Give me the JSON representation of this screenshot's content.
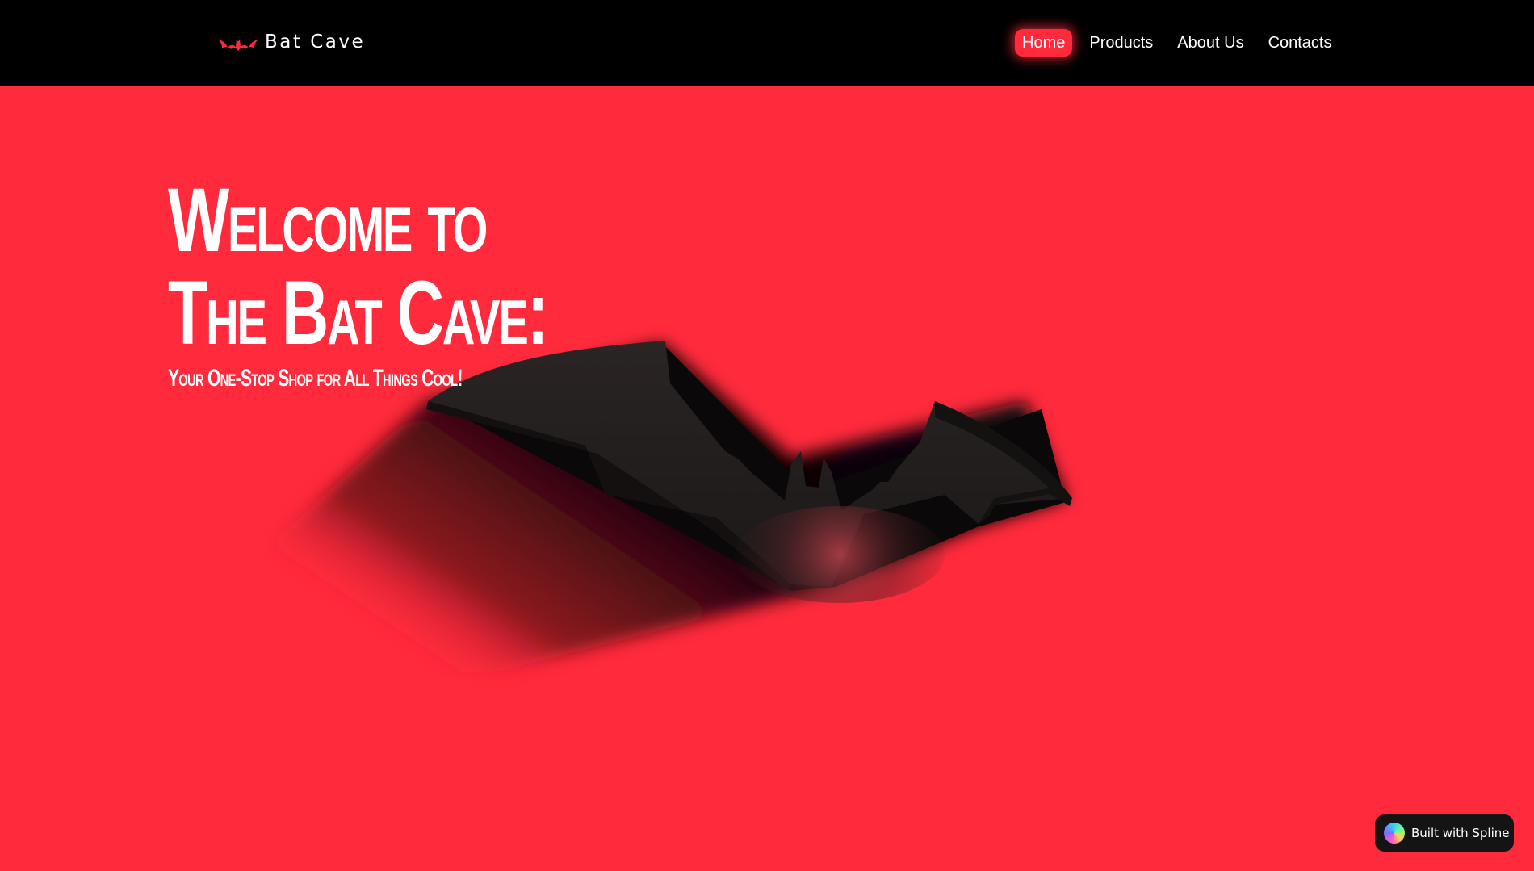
{
  "colors": {
    "accent": "#ff2a3c",
    "navbar_bg": "#000000",
    "text": "#ffffff",
    "badge_bg": "#141414"
  },
  "header": {
    "logo_icon": "bat-icon",
    "brand_name": "Bat Cave",
    "nav": [
      {
        "label": "Home",
        "active": true
      },
      {
        "label": "Products",
        "active": false
      },
      {
        "label": "About Us",
        "active": false
      },
      {
        "label": "Contacts",
        "active": false
      }
    ]
  },
  "hero": {
    "title_line1": "Welcome to",
    "title_line2": "The Bat Cave:",
    "subtitle": "Your One-Stop Shop for All Things Cool!",
    "scene_icon": "3d-bat-icon"
  },
  "badge": {
    "icon": "spline-logo-icon",
    "label": "Built with Spline"
  }
}
